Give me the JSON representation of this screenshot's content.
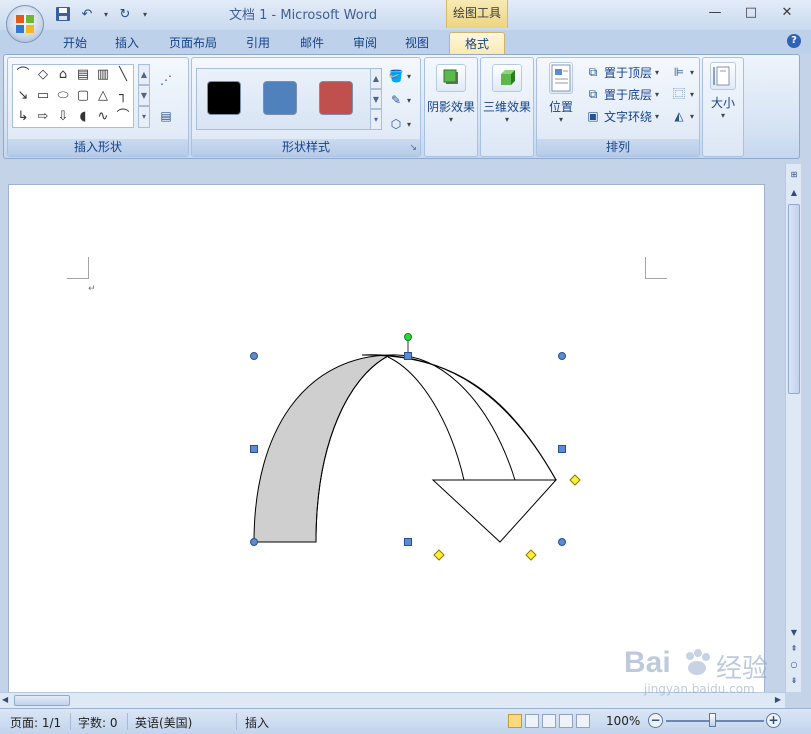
{
  "titlebar": {
    "title": "文档 1 - Microsoft Word",
    "context_label": "绘图工具",
    "minimize": "—",
    "maximize": "□",
    "close": "✕"
  },
  "tabs": [
    {
      "label": "开始"
    },
    {
      "label": "插入"
    },
    {
      "label": "页面布局"
    },
    {
      "label": "引用"
    },
    {
      "label": "邮件"
    },
    {
      "label": "审阅"
    },
    {
      "label": "视图"
    },
    {
      "label": "格式",
      "active": true
    }
  ],
  "ribbon": {
    "insert_shapes": {
      "label": "插入形状"
    },
    "shape_styles": {
      "label": "形状样式",
      "swatches": [
        "#000000",
        "#4f81bd",
        "#c0504d"
      ]
    },
    "shadow": {
      "label": "阴影效果"
    },
    "three_d": {
      "label": "三维效果"
    },
    "arrange": {
      "label": "排列",
      "position": "位置",
      "bring_front": "置于顶层",
      "send_back": "置于底层",
      "text_wrap": "文字环绕"
    },
    "size": {
      "label": "大小"
    }
  },
  "statusbar": {
    "page": "页面: 1/1",
    "words": "字数: 0",
    "language": "英语(美国)",
    "mode": "插入",
    "zoom": "100%"
  },
  "watermark": {
    "brand": "Bai",
    "brand2": "经验",
    "url": "jingyan.baidu.com"
  },
  "colors": {
    "arrow_fill": "#cfcfcf",
    "handle_blue": "#5b8bd4",
    "handle_yellow": "#ffee33",
    "rotate_green": "#22dd33"
  }
}
